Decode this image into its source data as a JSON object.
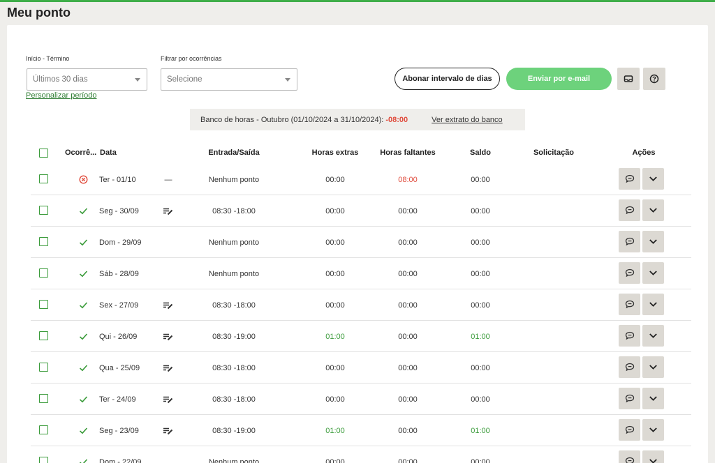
{
  "page": {
    "title": "Meu ponto"
  },
  "filters": {
    "period_label": "Início - Término",
    "period_value": "Últimos 30 dias",
    "customize_link": "Personalizar período",
    "occurrence_label": "Filtrar por ocorrências",
    "occurrence_placeholder": "Selecione"
  },
  "toolbar": {
    "abonar_label": "Abonar intervalo de dias",
    "email_label": "Enviar por e-mail"
  },
  "bank": {
    "text": "Banco de horas - Outubro (01/10/2024 a 31/10/2024):",
    "value": "-08:00",
    "link": "Ver extrato do banco"
  },
  "table": {
    "headers": {
      "occurrence": "Ocorrê...",
      "date": "Data",
      "entry_exit": "Entrada/Saída",
      "extra": "Horas extras",
      "missing": "Horas faltantes",
      "balance": "Saldo",
      "request": "Solicitação",
      "actions": "Ações"
    },
    "rows": [
      {
        "status": "error",
        "date": "Ter - 01/10",
        "edit": false,
        "dash": "—",
        "entry": "Nenhum ponto",
        "extra": "00:00",
        "missing": "08:00",
        "balance": "00:00"
      },
      {
        "status": "ok",
        "date": "Seg - 30/09",
        "edit": true,
        "dash": "",
        "entry": "08:30 -18:00",
        "extra": "00:00",
        "missing": "00:00",
        "balance": "00:00"
      },
      {
        "status": "ok",
        "date": "Dom - 29/09",
        "edit": false,
        "dash": "",
        "entry": "Nenhum ponto",
        "extra": "00:00",
        "missing": "00:00",
        "balance": "00:00"
      },
      {
        "status": "ok",
        "date": "Sáb - 28/09",
        "edit": false,
        "dash": "",
        "entry": "Nenhum ponto",
        "extra": "00:00",
        "missing": "00:00",
        "balance": "00:00"
      },
      {
        "status": "ok",
        "date": "Sex - 27/09",
        "edit": true,
        "dash": "",
        "entry": "08:30 -18:00",
        "extra": "00:00",
        "missing": "00:00",
        "balance": "00:00"
      },
      {
        "status": "ok",
        "date": "Qui - 26/09",
        "edit": true,
        "dash": "",
        "entry": "08:30 -19:00",
        "extra": "01:00",
        "missing": "00:00",
        "balance": "01:00"
      },
      {
        "status": "ok",
        "date": "Qua - 25/09",
        "edit": true,
        "dash": "",
        "entry": "08:30 -18:00",
        "extra": "00:00",
        "missing": "00:00",
        "balance": "00:00"
      },
      {
        "status": "ok",
        "date": "Ter - 24/09",
        "edit": true,
        "dash": "",
        "entry": "08:30 -18:00",
        "extra": "00:00",
        "missing": "00:00",
        "balance": "00:00"
      },
      {
        "status": "ok",
        "date": "Seg - 23/09",
        "edit": true,
        "dash": "",
        "entry": "08:30 -19:00",
        "extra": "01:00",
        "missing": "00:00",
        "balance": "01:00"
      },
      {
        "status": "ok",
        "date": "Dom - 22/09",
        "edit": false,
        "dash": "",
        "entry": "Nenhum ponto",
        "extra": "00:00",
        "missing": "00:00",
        "balance": "00:00"
      }
    ]
  },
  "colors": {
    "accent": "#3a9b3a",
    "negative": "#e04b3c",
    "button_green": "#6dd27c",
    "action_bg": "#dcd9d3"
  },
  "icons": {
    "status_error": "circle-x-icon",
    "status_ok": "check-icon",
    "edit": "edit-lines-icon",
    "comment": "chat-bubble-icon",
    "expand": "chevron-down-icon",
    "inbox": "inbox-icon",
    "help": "help-circle-icon"
  }
}
